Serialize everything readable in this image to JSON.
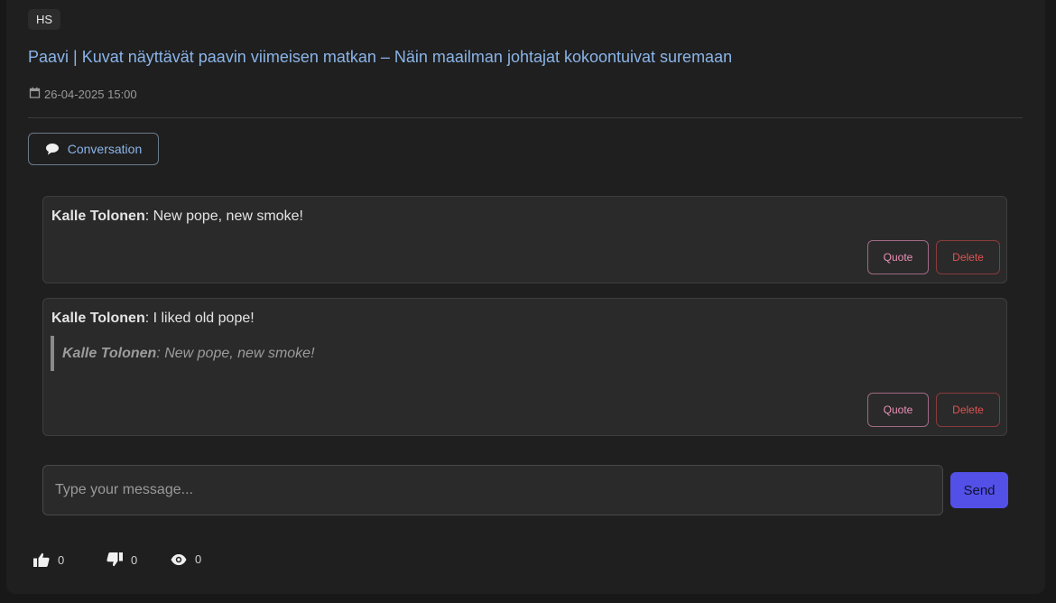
{
  "article": {
    "source": "HS",
    "title": "Paavi | Kuvat näyttävät paavin viimeisen matkan – Näin maailman johtajat kokoontuivat suremaan",
    "date": "26-04-2025 15:00"
  },
  "conversation_button": {
    "label": "Conversation",
    "icon": "speech-bubble-icon"
  },
  "messages": [
    {
      "author": "Kalle Tolonen",
      "text": ": New pope, new smoke!",
      "quote": null,
      "quote_label": "Quote",
      "delete_label": "Delete"
    },
    {
      "author": "Kalle Tolonen",
      "text": ": I liked old pope!",
      "quote": {
        "author": "Kalle Tolonen",
        "text": ": New pope, new smoke!"
      },
      "quote_label": "Quote",
      "delete_label": "Delete"
    }
  ],
  "composer": {
    "placeholder": "Type your message...",
    "send_label": "Send"
  },
  "stats": {
    "likes": "0",
    "dislikes": "0",
    "views": "0"
  },
  "colors": {
    "accent": "#5350e8",
    "link": "#8ab4e8",
    "quote_button": "#e890b4",
    "delete_button": "#e05252"
  }
}
